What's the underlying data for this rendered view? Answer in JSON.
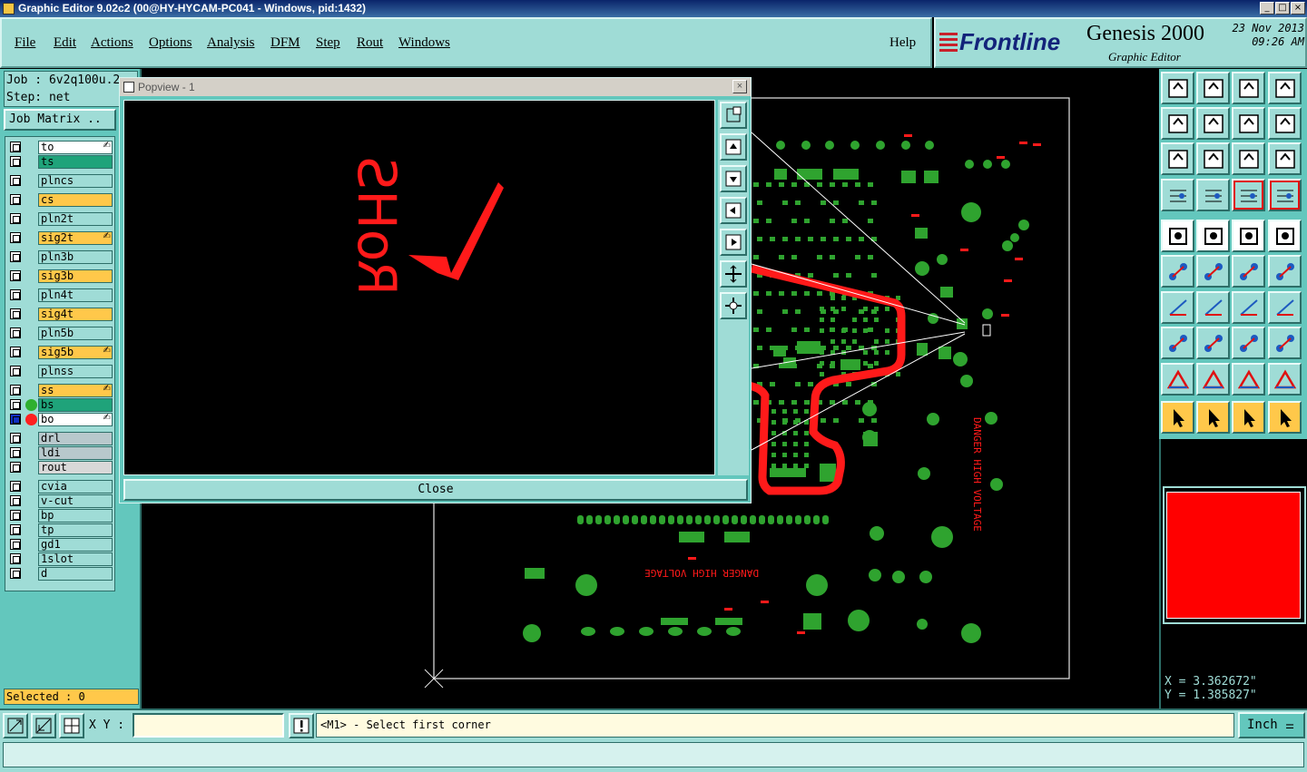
{
  "window": {
    "title": "Graphic Editor 9.02c2 (00@HY-HYCAM-PC041 - Windows, pid:1432)",
    "controls": [
      "_",
      "□",
      "×"
    ]
  },
  "menu": {
    "items": [
      "File",
      "Edit",
      "Actions",
      "Options",
      "Analysis",
      "DFM",
      "Step",
      "Rout",
      "Windows"
    ],
    "help": "Help"
  },
  "brand": {
    "logo": "Frontline",
    "product": "Genesis 2000",
    "subtitle": "Graphic Editor",
    "date": "23 Nov 2013",
    "time": "09:26 AM"
  },
  "job": {
    "job_line": "Job : 6v2q100u.2",
    "step_line": "Step: net",
    "matrix_button": "Job Matrix .."
  },
  "layers": [
    {
      "name": "to",
      "color": "#ffffff",
      "editable": true
    },
    {
      "name": "ts",
      "color": "#1fa37a",
      "editable": false
    },
    {
      "name": "plncs",
      "color": "#9fdcd6",
      "editable": false
    },
    {
      "name": "cs",
      "color": "#ffc84a",
      "editable": false
    },
    {
      "name": "pln2t",
      "color": "#9fdcd6",
      "editable": false
    },
    {
      "name": "sig2t",
      "color": "#ffc84a",
      "editable": true
    },
    {
      "name": "pln3b",
      "color": "#9fdcd6",
      "editable": false
    },
    {
      "name": "sig3b",
      "color": "#ffc84a",
      "editable": false
    },
    {
      "name": "pln4t",
      "color": "#9fdcd6",
      "editable": false
    },
    {
      "name": "sig4t",
      "color": "#ffc84a",
      "editable": false
    },
    {
      "name": "pln5b",
      "color": "#9fdcd6",
      "editable": false
    },
    {
      "name": "sig5b",
      "color": "#ffc84a",
      "editable": true
    },
    {
      "name": "plnss",
      "color": "#9fdcd6",
      "editable": false
    },
    {
      "name": "ss",
      "color": "#ffc84a",
      "editable": true
    },
    {
      "name": "bs",
      "color": "#1fa37a",
      "editable": false,
      "dot": "#2fb02f"
    },
    {
      "name": "bo",
      "color": "#ffffff",
      "editable": true,
      "dot": "#ff2020",
      "active": true
    },
    {
      "name": "drl",
      "color": "#b8c8cc",
      "editable": false
    },
    {
      "name": "ldi",
      "color": "#b8c8cc",
      "editable": false
    },
    {
      "name": "rout",
      "color": "#d8d8d8",
      "editable": false
    },
    {
      "name": "cvia",
      "color": "#9fdcd6",
      "editable": false
    },
    {
      "name": "v-cut",
      "color": "#9fdcd6",
      "editable": false
    },
    {
      "name": "bp",
      "color": "#9fdcd6",
      "editable": false
    },
    {
      "name": "tp",
      "color": "#9fdcd6",
      "editable": false
    },
    {
      "name": "gd1",
      "color": "#9fdcd6",
      "editable": false
    },
    {
      "name": "1slot",
      "color": "#9fdcd6",
      "editable": false
    },
    {
      "name": "d",
      "color": "#9fdcd6",
      "editable": false
    }
  ],
  "selected": "Selected : 0",
  "popview": {
    "title": "Popview - 1",
    "close_label": "Close",
    "rohs_text": "RoHS"
  },
  "board": {
    "danger_text": "DANGER HIGH VOLTAGE",
    "danger_text_vertical": "DANGER HIGH VOLTAGE"
  },
  "coords": {
    "x": "X = 3.362672\"",
    "y": "Y = 1.385827\""
  },
  "command": {
    "xy_label": "X Y :",
    "xy_value": "",
    "prompt": "<M1> - Select first corner",
    "units": "Inch"
  },
  "colors": {
    "panel": "#9fdcd6",
    "panel_dark": "#63c7bd",
    "copper_green": "#2fa32f",
    "silk_red": "#ff1a1a",
    "highlight": "#ffc84a"
  }
}
